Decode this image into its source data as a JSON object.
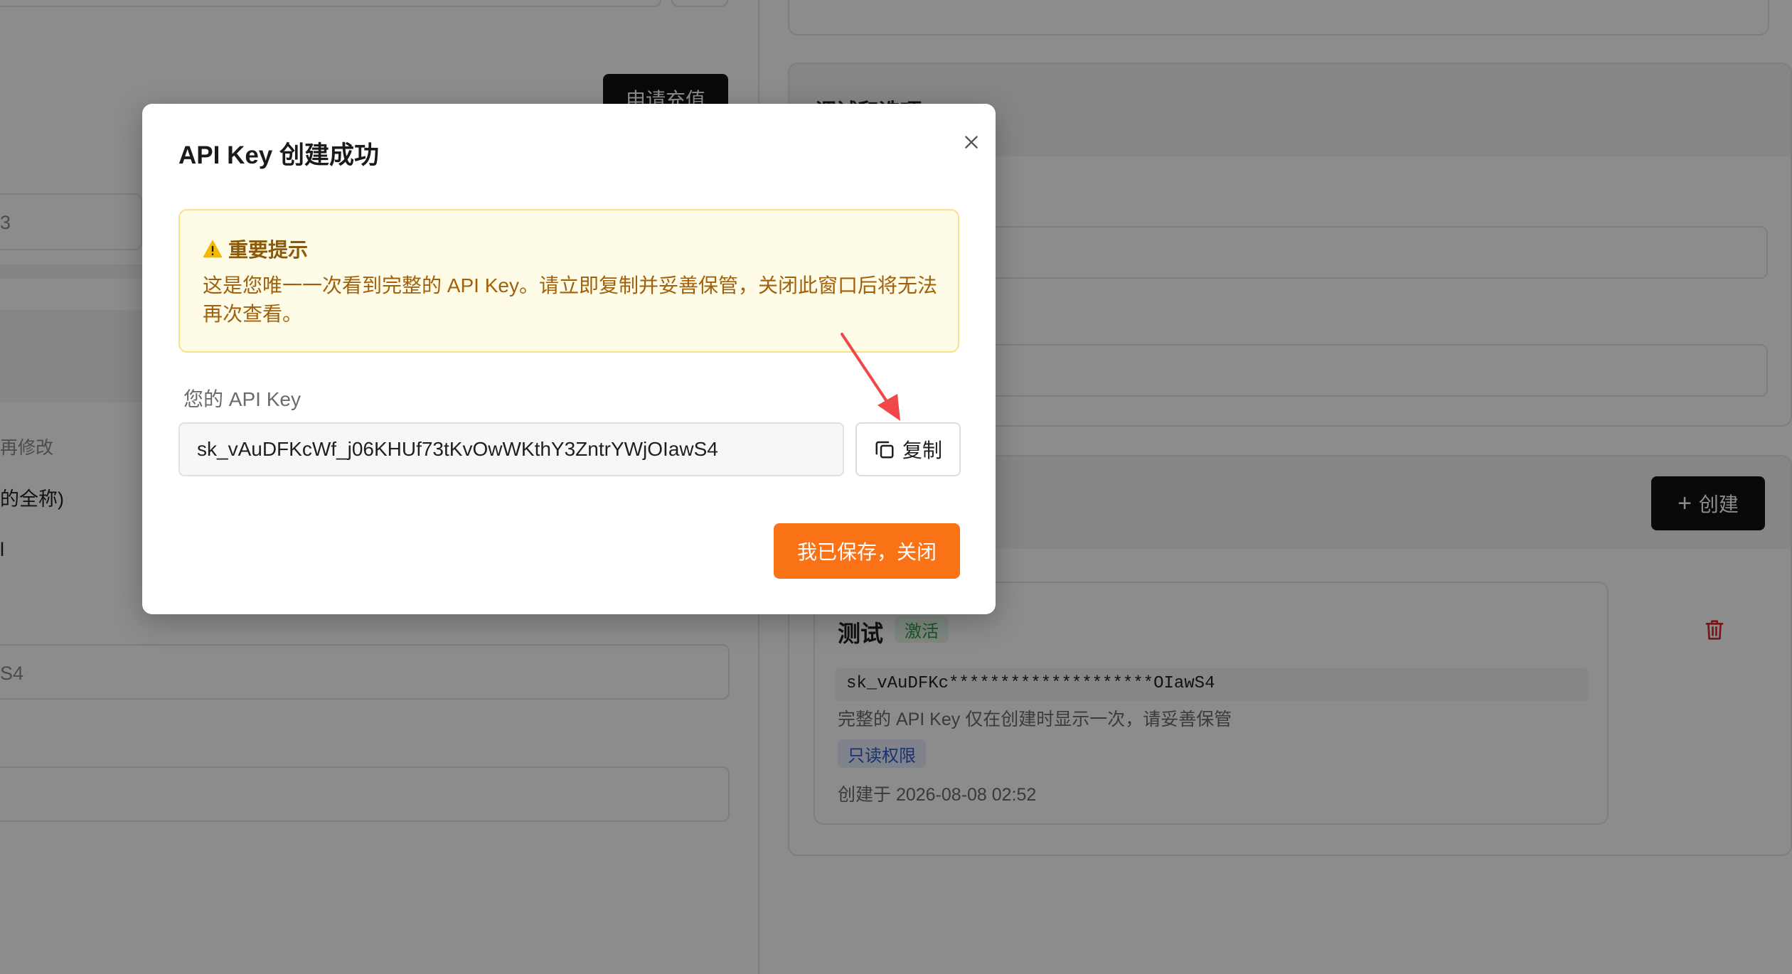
{
  "background": {
    "left_fragments": [
      "3",
      "再修改",
      "的全称)",
      "l",
      "S4"
    ],
    "recharge_label": "申请充值",
    "right_header": "调试和选项",
    "create_label": "创建",
    "key_card": {
      "name": "测试",
      "status": "激活",
      "masked_key": "sk_vAuDFKc********************OIawS4",
      "note": "完整的 API Key 仅在创建时显示一次，请妥善保管",
      "permission": "只读权限",
      "created_at": "创建于 2026-08-08 02:52"
    }
  },
  "modal": {
    "title": "API Key 创建成功",
    "alert": {
      "title": "重要提示",
      "body": "这是您唯一一次看到完整的 API Key。请立即复制并妥善保管，关闭此窗口后将无法再次查看。"
    },
    "key_label": "您的 API Key",
    "api_key": "sk_vAuDFKcWf_j06KHUf73tKvOwWKthY3ZntrYWjOIawS4",
    "copy_label": "复制",
    "save_label": "我已保存，关闭"
  },
  "colors": {
    "primary": "#f97316",
    "warning_bg": "#fefbe6",
    "warning_text": "#a1600c",
    "arrow": "#f0484a"
  }
}
